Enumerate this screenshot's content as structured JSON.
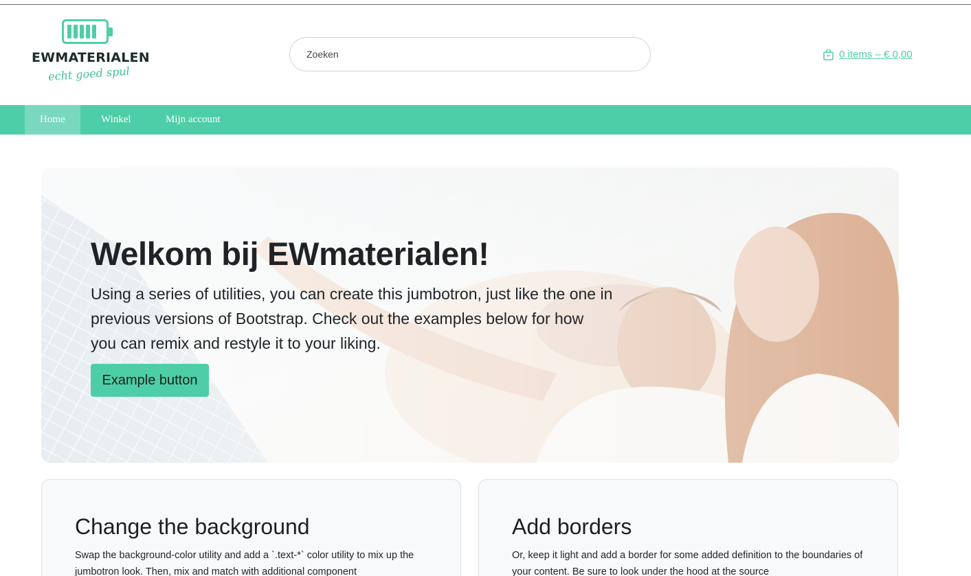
{
  "brand": {
    "name": "EWMATERIALEN",
    "tagline": "echt goed spul",
    "accent_color": "#4ecea6"
  },
  "search": {
    "placeholder": "Zoeken"
  },
  "cart": {
    "icon": "shopping-bag-icon",
    "label": "0 items – € 0,00"
  },
  "nav": {
    "items": [
      {
        "label": "Home",
        "active": true
      },
      {
        "label": "Winkel",
        "active": false
      },
      {
        "label": "Mijn account",
        "active": false
      }
    ]
  },
  "hero": {
    "title": "Welkom bij EWmaterialen!",
    "text": "Using a series of utilities, you can create this jumbotron, just like the one in previous versions of Bootstrap. Check out the examples below for how you can remix and restyle it to your liking.",
    "button_label": "Example button"
  },
  "cards": [
    {
      "title": "Change the background",
      "text": "Swap the background-color utility and add a `.text-*` color utility to mix up the jumbotron look. Then, mix and match with additional component"
    },
    {
      "title": "Add borders",
      "text": "Or, keep it light and add a border for some added definition to the boundaries of your content. Be sure to look under the hood at the source"
    }
  ]
}
